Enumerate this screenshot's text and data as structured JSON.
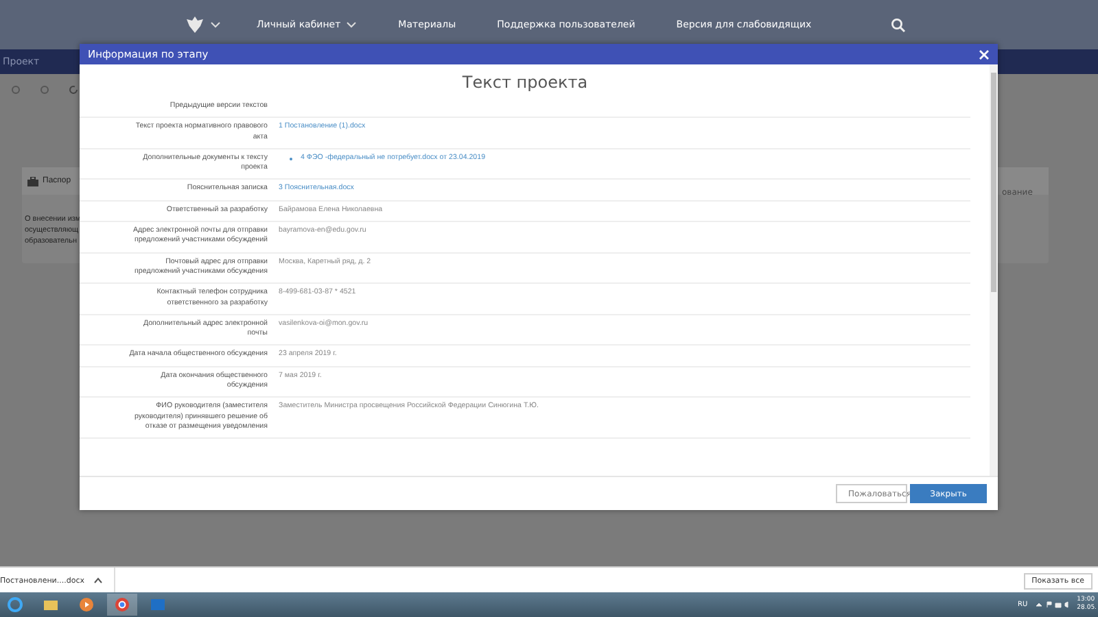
{
  "nav": {
    "items": [
      "Личный кабинет",
      "Материалы",
      "Поддержка пользователей",
      "Версия для слабовидящих"
    ]
  },
  "window": {
    "title": "Проект"
  },
  "background_card": {
    "tab": "Паспор",
    "lines": [
      "О внесении изм",
      "осуществляющ",
      "образовательн"
    ],
    "right_text": "ование"
  },
  "dialog": {
    "title": "Информация по этапу",
    "heading": "Текст проекта",
    "rows": [
      {
        "label": "Предыдущие версии текстов",
        "kind": "text",
        "value": ""
      },
      {
        "label": "Текст проекта нормативного правового акта",
        "kind": "link",
        "value": "1 Постановление (1).docx"
      },
      {
        "label": "Дополнительные документы к тексту проекта",
        "kind": "bullet",
        "value": "4 ФЭО -федеральный не потребует.docx от 23.04.2019"
      },
      {
        "label": "Пояснительная записка",
        "kind": "link",
        "value": "3 Пояснительная.docx"
      },
      {
        "label": "Ответственный за разработку",
        "kind": "text",
        "value": "Байрамова Елена Николаевна"
      },
      {
        "label": "Адрес электронной почты для отправки предложений участниками обсуждений",
        "kind": "text",
        "value": "bayramova-en@edu.gov.ru"
      },
      {
        "label": "Почтовый адрес для отправки предложений участниками обсуждения",
        "kind": "text",
        "value": "Москва, Каретный ряд, д. 2"
      },
      {
        "label": "Контактный телефон сотрудника ответственного за разработку",
        "kind": "text",
        "value": "8-499-681-03-87 * 4521"
      },
      {
        "label": "Дополнительный адрес электронной почты",
        "kind": "text",
        "value": "vasilenkova-oi@mon.gov.ru"
      },
      {
        "label": "Дата начала общественного обсуждения",
        "kind": "text",
        "value": "23 апреля 2019 г."
      },
      {
        "label": "Дата окончания общественного обсуждения",
        "kind": "text",
        "value": "7 мая 2019 г."
      },
      {
        "label": "ФИО руководителя (заместителя руководителя) принявшего решение об отказе от размещения уведомления",
        "kind": "text",
        "value": "Заместитель Министра просвещения Российской Федерации Синюгина Т.Ю."
      }
    ],
    "buttons": [
      {
        "label": "Пожаловаться",
        "kind": "secondary"
      },
      {
        "label": "Закрыть",
        "kind": "primary"
      }
    ]
  },
  "download_bar": {
    "file": "Постановлени....docx",
    "show_all": "Показать все"
  },
  "taskbar": {
    "language": "RU",
    "time": "13:00",
    "date": "28.05."
  }
}
